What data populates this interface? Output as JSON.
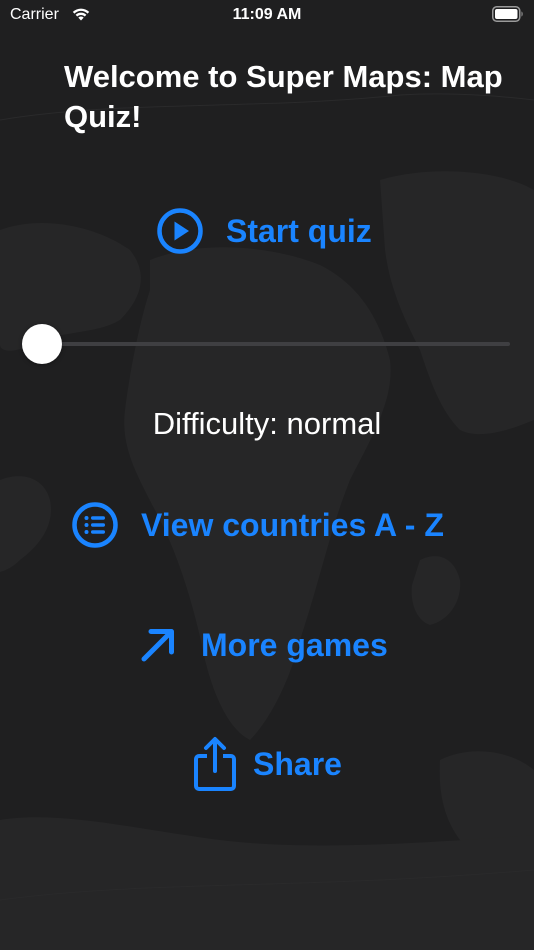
{
  "status_bar": {
    "carrier": "Carrier",
    "time": "11:09 AM"
  },
  "title": "Welcome to Super Maps: Map Quiz!",
  "actions": {
    "start_quiz": {
      "label": "Start quiz",
      "icon": "play-circle-icon"
    },
    "view_countries": {
      "label": "View countries A - Z",
      "icon": "list-circle-icon"
    },
    "more_games": {
      "label": "More games",
      "icon": "arrow-up-right-icon"
    },
    "share": {
      "label": "Share",
      "icon": "share-icon"
    }
  },
  "difficulty": {
    "label": "Difficulty: normal",
    "slider_value": 0
  },
  "colors": {
    "accent": "#1a84ff",
    "background": "#1f1f20",
    "text": "#ffffff"
  }
}
